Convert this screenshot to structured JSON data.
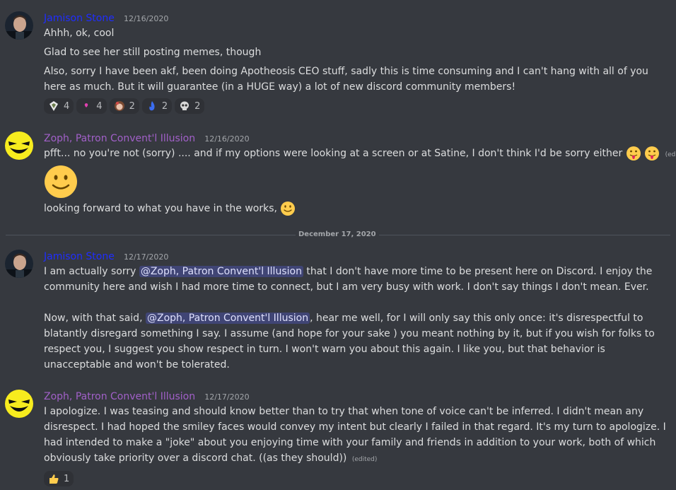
{
  "messages": [
    {
      "author": "Jamison Stone",
      "author_color": "#1f2dff",
      "timestamp": "12/16/2020",
      "lines": [
        "Ahhh, ok, cool",
        "Glad to see her still posting memes, though",
        "Also, sorry I have been akf, been doing Apotheosis CEO stuff, sadly this is time consuming and I can't hang with all of you here as much. But it will guarantee (in a HUGE way) a lot of new discord community members!"
      ],
      "reactions": [
        {
          "emoji": "shield-emoji",
          "count": "4"
        },
        {
          "emoji": "pink-heart-emoji",
          "count": "4"
        },
        {
          "emoji": "girl-face-emoji",
          "count": "2"
        },
        {
          "emoji": "blue-flame-emoji",
          "count": "2"
        },
        {
          "emoji": "skull-emoji",
          "count": "2"
        }
      ]
    },
    {
      "author": "Zoph, Patron Convent'l Illusion",
      "author_color": "#a160c8",
      "timestamp": "12/16/2020",
      "line1": "pfft... no you're not (sorry) .... and if my options were looking at a screen or at Satine, I don't think I'd be sorry either",
      "edited": "(edited)",
      "line3": "looking forward to what you have in the works,"
    },
    {
      "author": "Jamison Stone",
      "author_color": "#1f2dff",
      "timestamp": "12/17/2020",
      "p1_a": "I am actually sorry",
      "mention": "@Zoph, Patron Convent'l Illusion",
      "p1_b": "that I don't have more time to be present here on Discord. I enjoy the community here and wish I had more time to connect, but I am very busy with work. I don't say things I don't mean. Ever.",
      "p2_a": "Now, with that said,",
      "p2_b": ", hear me well, for I will only say this only once: it's disrespectful to blatantly disregard something I say. I assume (and hope for your sake ) you meant nothing by it, but if you wish for folks to respect you, I suggest you show respect in turn. I won't warn you about this again. I like you, but that behavior is unacceptable and won't be tolerated."
    },
    {
      "author": "Zoph, Patron Convent'l Illusion",
      "author_color": "#a160c8",
      "timestamp": "12/17/2020",
      "text": "I apologize.  I was teasing and should know better than to try that when tone of voice can't be inferred.  I didn't mean any disrespect. I had hoped the smiley faces would convey my intent but clearly I failed in that regard.   It's my turn to apologize.  I had intended to make a \"joke\" about you enjoying time with your family and friends in addition to your work, both of which obviously take priority over a discord chat. ((as they should))",
      "edited": "(edited)",
      "reactions": [
        {
          "emoji": "thumbs-up-emoji",
          "count": "1"
        }
      ]
    }
  ],
  "date_divider": "December 17, 2020",
  "colors": {
    "background": "#36393f",
    "mention_bg": "#4f55a0",
    "reaction_bg": "#2f3136"
  }
}
